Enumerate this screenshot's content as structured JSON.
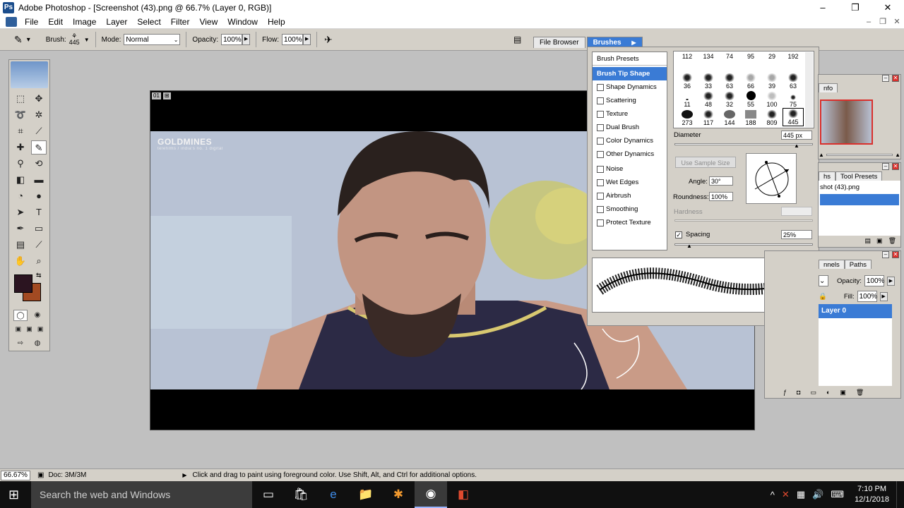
{
  "window": {
    "title": "Adobe Photoshop - [Screenshot (43).png @ 66.7% (Layer 0, RGB)]",
    "buttons": [
      "–",
      "❐",
      "✕"
    ]
  },
  "menu": [
    "File",
    "Edit",
    "Image",
    "Layer",
    "Select",
    "Filter",
    "View",
    "Window",
    "Help"
  ],
  "options": {
    "brush_label": "Brush:",
    "brush_size": "445",
    "mode_label": "Mode:",
    "mode_value": "Normal",
    "opacity_label": "Opacity:",
    "opacity_value": "100%",
    "flow_label": "Flow:",
    "flow_value": "100%"
  },
  "palette_well": {
    "tabs": [
      "File Browser",
      "Brushes"
    ]
  },
  "document": {
    "badge": [
      "01",
      "⊞"
    ],
    "watermark": "GOLDMINES",
    "watermark_sub": "telefilms / india's no. 1 digital"
  },
  "brushes": {
    "left_items": [
      {
        "label": "Brush Presets",
        "type": "header"
      },
      {
        "label": "Brush Tip Shape",
        "type": "active"
      },
      {
        "label": "Shape Dynamics",
        "type": "check"
      },
      {
        "label": "Scattering",
        "type": "check"
      },
      {
        "label": "Texture",
        "type": "check"
      },
      {
        "label": "Dual Brush",
        "type": "check"
      },
      {
        "label": "Color Dynamics",
        "type": "check"
      },
      {
        "label": "Other Dynamics",
        "type": "check"
      },
      {
        "label": "Noise",
        "type": "check"
      },
      {
        "label": "Wet Edges",
        "type": "check"
      },
      {
        "label": "Airbrush",
        "type": "check"
      },
      {
        "label": "Smoothing",
        "type": "check"
      },
      {
        "label": "Protect Texture",
        "type": "check"
      }
    ],
    "tip_sizes": [
      "112",
      "134",
      "74",
      "95",
      "29",
      "192",
      "36",
      "33",
      "63",
      "66",
      "39",
      "63",
      "11",
      "48",
      "32",
      "55",
      "100",
      "75",
      "273",
      "117",
      "144",
      "188",
      "809",
      "445"
    ],
    "diameter_label": "Diameter",
    "diameter_value": "445 px",
    "use_sample": "Use Sample Size",
    "angle_label": "Angle:",
    "angle_value": "30°",
    "roundness_label": "Roundness:",
    "roundness_value": "100%",
    "hardness_label": "Hardness",
    "spacing_label": "Spacing",
    "spacing_value": "25%",
    "spacing_checked": true
  },
  "panels": {
    "navigator_tab": "nfo",
    "history_tabs": [
      "hs",
      "Tool Presets"
    ],
    "history_item": "shot (43).png",
    "layers_tabs": [
      "nnels",
      "Paths"
    ],
    "opacity_label": "Opacity:",
    "opacity_value": "100%",
    "fill_label": "Fill:",
    "fill_value": "100%",
    "layer_name": "Layer 0"
  },
  "status": {
    "zoom": "66.67%",
    "doc": "Doc: 3M/3M",
    "hint": "Click and drag to paint using foreground color.  Use Shift, Alt, and Ctrl for additional options."
  },
  "taskbar": {
    "search_placeholder": "Search the web and Windows",
    "time": "7:10 PM",
    "date": "12/1/2018"
  },
  "colors": {
    "foreground": "#2b1420",
    "background": "#a24a22",
    "accent": "#3a7bd5"
  }
}
